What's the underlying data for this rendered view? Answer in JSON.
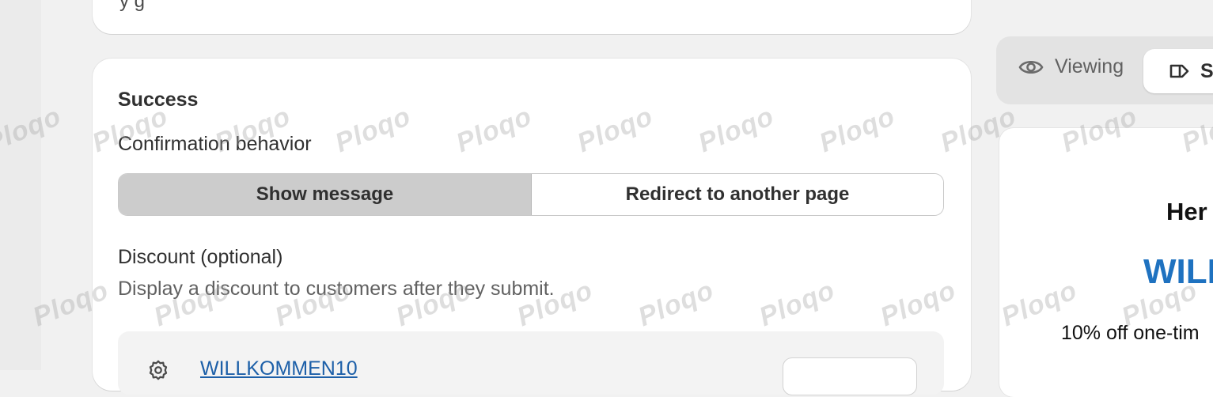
{
  "top_card": {
    "cut_text": "y g"
  },
  "success_card": {
    "title": "Success",
    "confirmation_label": "Confirmation behavior",
    "options": [
      "Show message",
      "Redirect to another page"
    ],
    "selected_option": "Show message",
    "discount_label": "Discount (optional)",
    "discount_help": "Display a discount to customers after they submit.",
    "discount_code": "WILLKOMMEN10"
  },
  "preview_toolbar": {
    "viewing_label": "Viewing",
    "tab_label": "Su",
    "icons": [
      "eye-icon",
      "tag-icon"
    ]
  },
  "preview": {
    "heading": "Her",
    "code": "WILL",
    "offer": "10% off one-tim"
  },
  "watermark": "Ploqo",
  "colors": {
    "background": "#f1f1f1",
    "card": "#ffffff",
    "selected_segment": "#cccccc",
    "link": "#1c5fa8",
    "preview_code": "#1f72c0"
  }
}
